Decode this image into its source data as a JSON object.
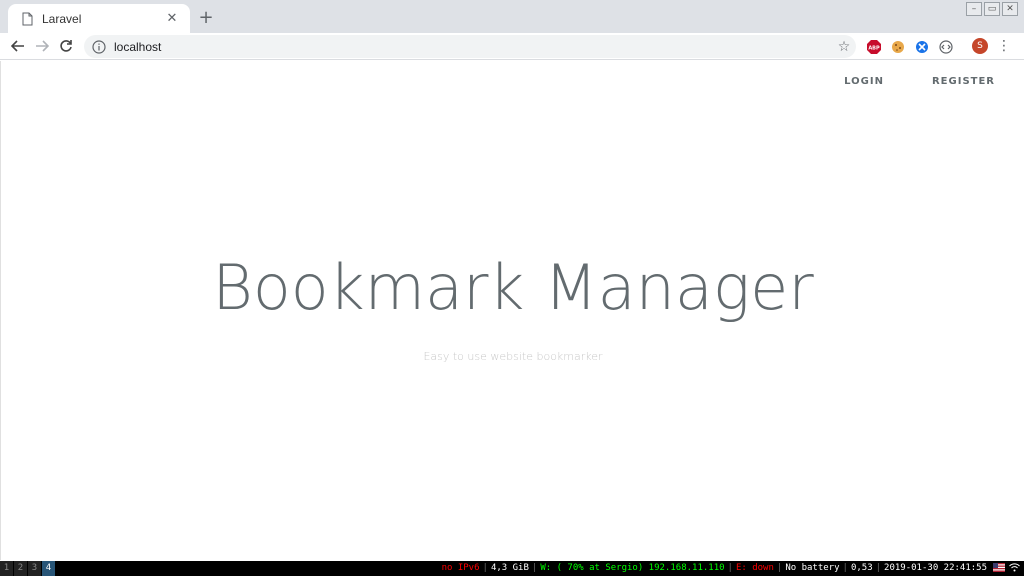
{
  "browser": {
    "tab_title": "Laravel",
    "url": "localhost",
    "new_tab": "+",
    "tab_close": "✕",
    "avatar_letter": "S",
    "extensions": [
      "adblock-plus-icon",
      "cookie-icon",
      "extension-blue-icon",
      "code-icon"
    ]
  },
  "page": {
    "nav": {
      "login": "LOGIN",
      "register": "REGISTER"
    },
    "title": "Bookmark Manager",
    "subtitle": "Easy to use website bookmarker"
  },
  "statusbar": {
    "workspaces": [
      "1",
      "2",
      "3",
      "4"
    ],
    "active_workspace": "4",
    "items": [
      {
        "text": "no IPv6",
        "color": "#ff0000"
      },
      {
        "text": "4,3 GiB",
        "color": "#ffffff"
      },
      {
        "text": "W: ( 70% at Sergio) 192.168.11.110",
        "color": "#00ff00"
      },
      {
        "text": "E: down",
        "color": "#ff0000"
      },
      {
        "text": "No battery",
        "color": "#ffffff"
      },
      {
        "text": "0,53",
        "color": "#ffffff"
      },
      {
        "text": "2019-01-30 22:41:55",
        "color": "#ffffff"
      }
    ]
  }
}
